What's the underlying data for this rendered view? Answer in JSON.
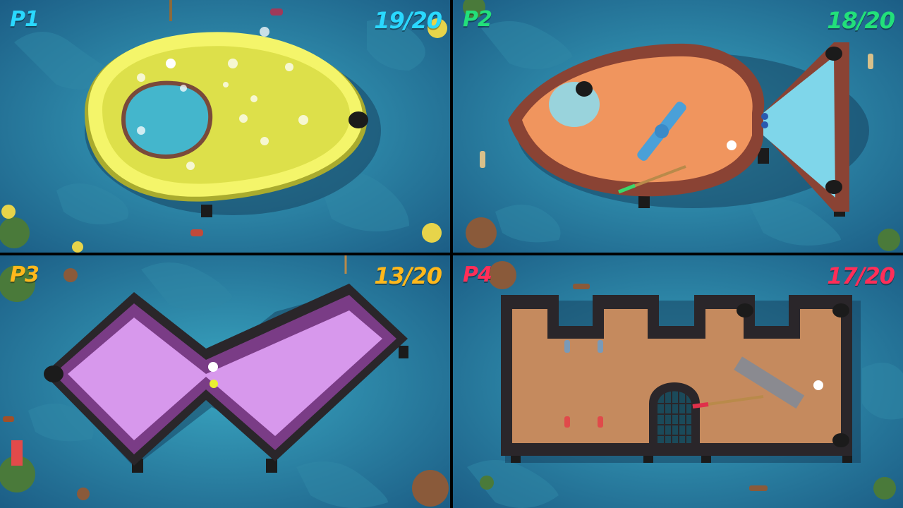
{
  "players": [
    {
      "id": "p1",
      "label": "P1",
      "score": "19/20",
      "color": "#2ad8ff"
    },
    {
      "id": "p2",
      "label": "P2",
      "score": "18/20",
      "color": "#22e07a"
    },
    {
      "id": "p3",
      "label": "P3",
      "score": "13/20",
      "color": "#ffb81c"
    },
    {
      "id": "p4",
      "label": "P4",
      "score": "17/20",
      "color": "#ff2e58"
    }
  ],
  "courses": {
    "p1": {
      "shape": "egg",
      "surface": "#dde04a",
      "rim": "#f4f56a"
    },
    "p2": {
      "shape": "fish",
      "surface": "#f0955e",
      "rim": "#8a4334"
    },
    "p3": {
      "shape": "zigzag",
      "surface": "#d798ec",
      "rim": "#7a3c86"
    },
    "p4": {
      "shape": "castle",
      "surface": "#c58a5e",
      "rim": "#2a262a"
    }
  },
  "water_color": "#2b8fb0"
}
